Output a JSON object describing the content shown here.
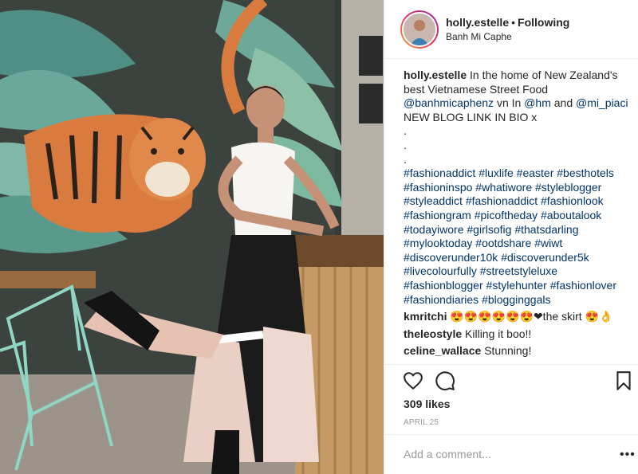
{
  "post": {
    "username": "holly.estelle",
    "separator": "•",
    "follow_state": "Following",
    "location": "Banh Mi Caphe"
  },
  "caption": {
    "username": "holly.estelle",
    "text_1": "In the home of New Zealand's best Vietnamese Street Food",
    "mention_1": "@banhmicaphenz",
    "text_2": "vn In",
    "mention_2": "@hm",
    "text_3": "and",
    "mention_3": "@mi_piaci",
    "text_4": "NEW BLOG LINK IN BIO x",
    "dots": [
      ".",
      ".",
      "."
    ],
    "hashtags": [
      "#fashionaddict",
      "#luxlife",
      "#easter",
      "#besthotels",
      "#fashioninspo",
      "#whatiwore",
      "#styleblogger",
      "#styleaddict",
      "#fashionaddict",
      "#fashionlook",
      "#fashiongram",
      "#picoftheday",
      "#aboutalook",
      "#todayiwore",
      "#girlsofig",
      "#thatsdarling",
      "#mylooktoday",
      "#ootdshare",
      "#wiwt",
      "#discoverunder10k",
      "#discoverunder5k",
      "#livecolourfully",
      "#streetstyleluxe",
      "#fashionblogger",
      "#stylehunter",
      "#fashionlover",
      "#fashiondiaries",
      "#blogginggals"
    ]
  },
  "comments": [
    {
      "user": "kmritchi",
      "text": "😍😍😍😍😍😍❤the skirt 😍👌"
    },
    {
      "user": "theleostyle",
      "text": "Killing it boo!!"
    },
    {
      "user": "celine_wallace",
      "text": "Stunning!"
    }
  ],
  "stats": {
    "likes": "309 likes",
    "date": "APRIL 25"
  },
  "composer": {
    "placeholder": "Add a comment...",
    "more_label": "•••"
  },
  "icons": {
    "like": "heart-icon",
    "comment": "speech-bubble-icon",
    "save": "bookmark-icon",
    "options": "more-icon"
  },
  "colors": {
    "link": "#003569",
    "muted": "#999999",
    "text": "#262626",
    "border": "#efefef"
  }
}
